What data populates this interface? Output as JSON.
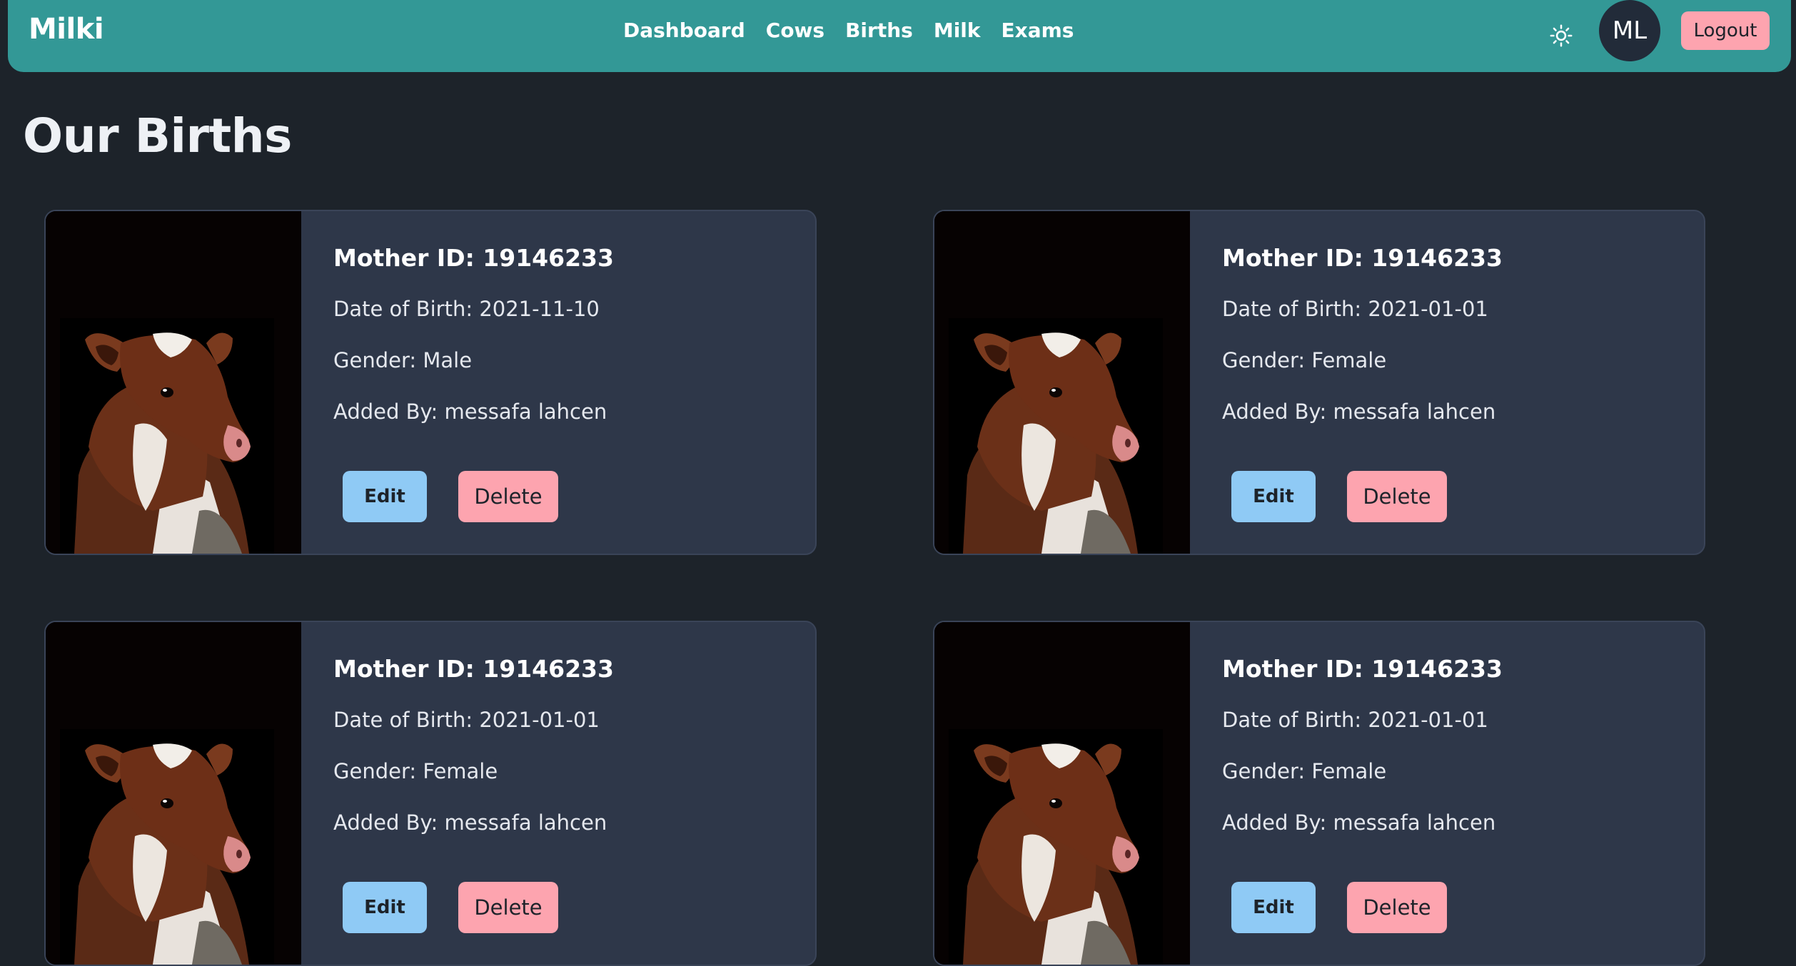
{
  "brand": "Milki",
  "nav": {
    "links": [
      "Dashboard",
      "Cows",
      "Births",
      "Milk",
      "Exams"
    ],
    "avatar_initials": "ML",
    "logout_label": "Logout",
    "theme_icon": "sun-icon"
  },
  "page_title": "Our Births",
  "births": [
    {
      "title": "Mother ID: 19146233",
      "dob": "Date of Birth: 2021-11-10",
      "gender": "Gender: Male",
      "added_by": "Added By: messafa lahcen",
      "edit_label": "Edit",
      "delete_label": "Delete"
    },
    {
      "title": "Mother ID: 19146233",
      "dob": "Date of Birth: 2021-01-01",
      "gender": "Gender: Female",
      "added_by": "Added By: messafa lahcen",
      "edit_label": "Edit",
      "delete_label": "Delete"
    },
    {
      "title": "Mother ID: 19146233",
      "dob": "Date of Birth: 2021-01-01",
      "gender": "Gender: Female",
      "added_by": "Added By: messafa lahcen",
      "edit_label": "Edit",
      "delete_label": "Delete"
    },
    {
      "title": "Mother ID: 19146233",
      "dob": "Date of Birth: 2021-01-01",
      "gender": "Gender: Female",
      "added_by": "Added By: messafa lahcen",
      "edit_label": "Edit",
      "delete_label": "Delete"
    }
  ],
  "colors": {
    "navbar": "#339896",
    "background": "#1d232a",
    "card": "#2e3749",
    "edit_button": "#8fcaf5",
    "delete_button": "#fda4af"
  }
}
